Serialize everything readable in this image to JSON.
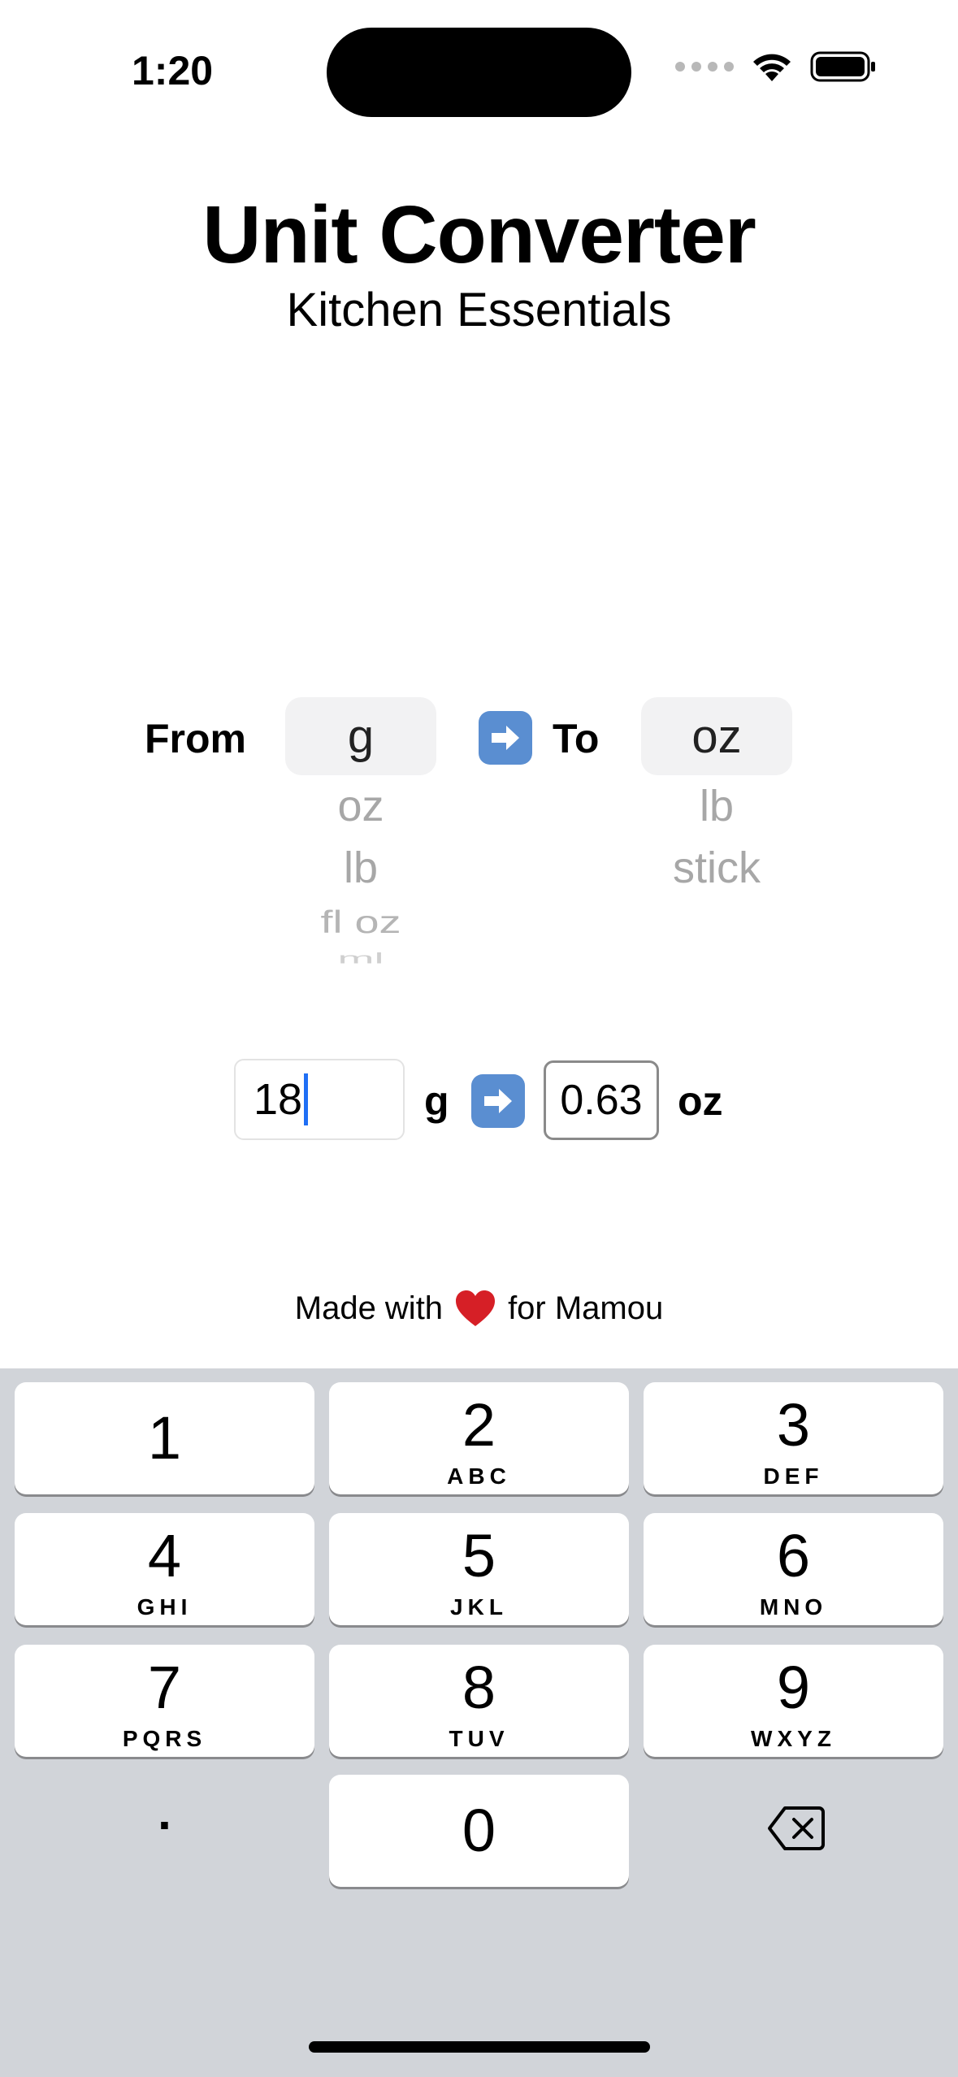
{
  "status": {
    "time": "1:20"
  },
  "header": {
    "title": "Unit Converter",
    "subtitle": "Kitchen Essentials"
  },
  "picker": {
    "from_label": "From",
    "to_label": "To",
    "from_selected": "g",
    "from_options": [
      "oz",
      "lb",
      "fl oz",
      "ml"
    ],
    "to_selected": "oz",
    "to_options": [
      "lb",
      "stick"
    ]
  },
  "conversion": {
    "input_value": "18",
    "from_unit": "g",
    "output_value": "0.63",
    "to_unit": "oz"
  },
  "footer": {
    "text_before": "Made with",
    "text_after": "for Mamou"
  },
  "keyboard": {
    "keys": [
      {
        "num": "1",
        "letters": ""
      },
      {
        "num": "2",
        "letters": "ABC"
      },
      {
        "num": "3",
        "letters": "DEF"
      },
      {
        "num": "4",
        "letters": "GHI"
      },
      {
        "num": "5",
        "letters": "JKL"
      },
      {
        "num": "6",
        "letters": "MNO"
      },
      {
        "num": "7",
        "letters": "PQRS"
      },
      {
        "num": "8",
        "letters": "TUV"
      },
      {
        "num": "9",
        "letters": "WXYZ"
      },
      {
        "num": "0",
        "letters": ""
      }
    ],
    "dot": ".",
    "delete_icon": "delete-left-icon"
  },
  "colors": {
    "caret": "#1f6ff5",
    "emoji_arrow_bg": "#5a8ed1",
    "keyboard_bg": "#d1d4d9"
  }
}
